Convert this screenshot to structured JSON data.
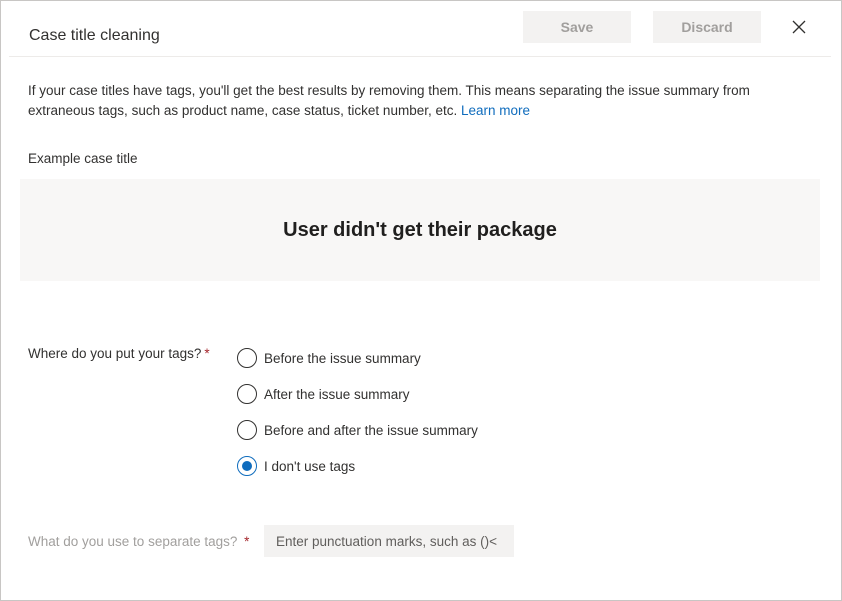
{
  "header": {
    "title": "Case title cleaning",
    "save_label": "Save",
    "discard_label": "Discard",
    "close_icon": "close-icon"
  },
  "intro": {
    "text": "If your case titles have tags, you'll get the best results by removing them. This means separating the issue summary from extraneous tags, such as product name, case status, ticket number, etc.",
    "link_text": "Learn more"
  },
  "example": {
    "label": "Example case title",
    "title": "User didn't get their package"
  },
  "tags_question": {
    "label": "Where do you put your tags?",
    "required_mark": "*",
    "options": [
      {
        "label": "Before the issue summary",
        "checked": false
      },
      {
        "label": "After the issue summary",
        "checked": false
      },
      {
        "label": "Before and after the issue summary",
        "checked": false
      },
      {
        "label": "I don't use tags",
        "checked": true
      }
    ]
  },
  "separator": {
    "label": "What do you use to separate tags?",
    "required_mark": "*",
    "value": "",
    "placeholder": "Enter punctuation marks, such as ()<"
  },
  "colors": {
    "accent": "#0f6cbd",
    "required": "#a4262c",
    "disabled_text": "#a19f9d",
    "button_bg": "#f3f2f1",
    "example_bg": "#f8f7f6"
  }
}
